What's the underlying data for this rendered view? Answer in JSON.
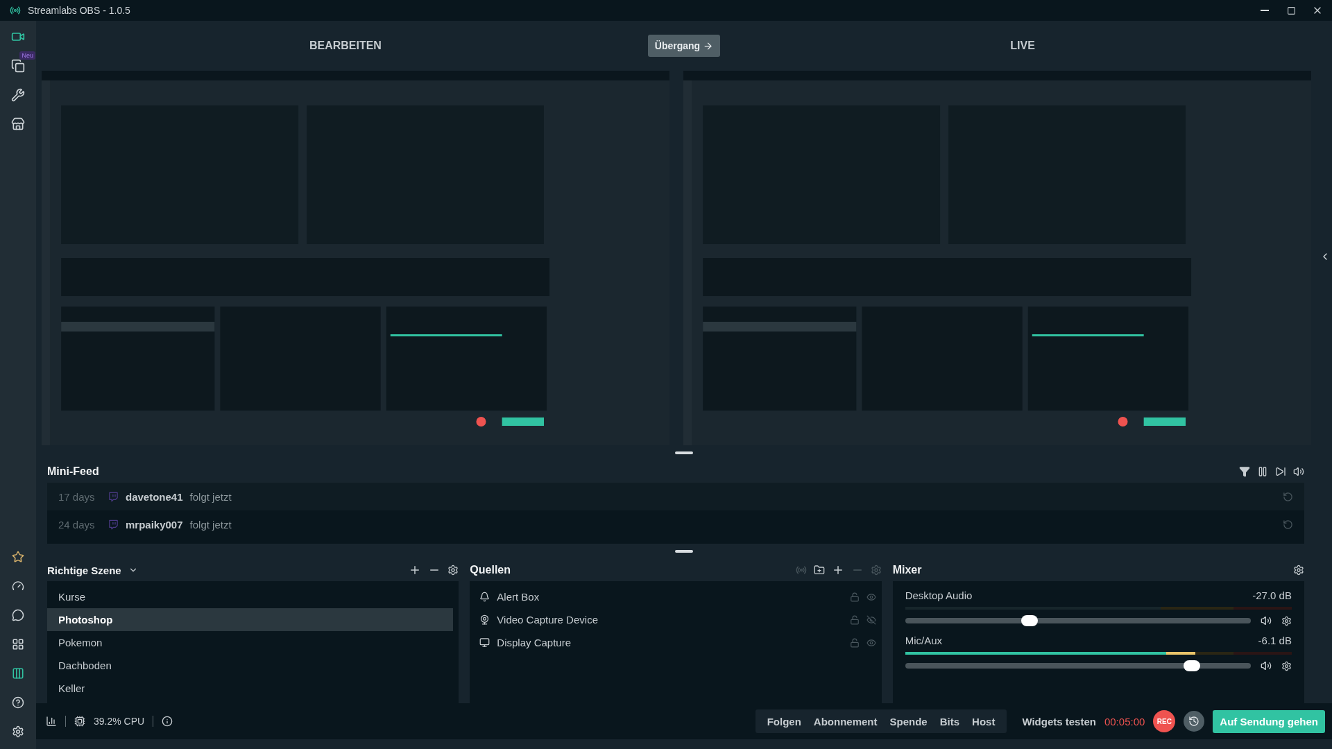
{
  "window": {
    "title": "Streamlabs OBS - 1.0.5"
  },
  "sidebar": {
    "top_items": [
      {
        "kind": "editor",
        "selected": true
      },
      {
        "kind": "themes",
        "badge": "Neu",
        "selected": false
      },
      {
        "kind": "tools",
        "selected": false
      },
      {
        "kind": "store",
        "selected": false
      }
    ],
    "bottom_items": [
      {
        "kind": "prime",
        "active": false
      },
      {
        "kind": "dashboard",
        "active": false
      },
      {
        "kind": "chat",
        "active": false
      },
      {
        "kind": "layout",
        "active": false
      },
      {
        "kind": "studio",
        "active": true
      },
      {
        "kind": "help",
        "active": false
      },
      {
        "kind": "settings",
        "active": false
      }
    ]
  },
  "header": {
    "edit_label": "BEARBEITEN",
    "transition_button": "Übergang",
    "live_label": "LIVE"
  },
  "mini_feed": {
    "title": "Mini-Feed",
    "events": [
      {
        "time": "17 days",
        "user": "davetone41",
        "action": "folgt jetzt"
      },
      {
        "time": "24 days",
        "user": "mrpaiky007",
        "action": "folgt jetzt"
      }
    ]
  },
  "scenes": {
    "title": "Richtige Szene",
    "items": [
      {
        "name": "Kurse",
        "selected": false
      },
      {
        "name": "Photoshop",
        "selected": true
      },
      {
        "name": "Pokemon",
        "selected": false
      },
      {
        "name": "Dachboden",
        "selected": false
      },
      {
        "name": "Keller",
        "selected": false
      }
    ]
  },
  "sources": {
    "title": "Quellen",
    "items": [
      {
        "name": "Alert Box",
        "kind": "alert",
        "visible": true
      },
      {
        "name": "Video Capture Device",
        "kind": "camera",
        "visible": false
      },
      {
        "name": "Display Capture",
        "kind": "display",
        "visible": true
      }
    ]
  },
  "mixer": {
    "title": "Mixer",
    "channels": [
      {
        "name": "Desktop Audio",
        "reading": "-27.0 dB",
        "meter": {
          "level": 0
        },
        "slider": {
          "level": 0.36
        }
      },
      {
        "name": "Mic/Aux",
        "reading": "-6.1 dB",
        "meter": {
          "level": 0.75
        },
        "slider": {
          "level": 0.83
        }
      }
    ]
  },
  "footer": {
    "cpu": "39.2% CPU",
    "alerts": [
      "Folgen",
      "Abonnement",
      "Spende",
      "Bits",
      "Host"
    ],
    "widgets_label": "Widgets testen",
    "timer": "00:05:00",
    "rec_button": "REC",
    "go_live_button": "Auf Sendung gehen"
  }
}
